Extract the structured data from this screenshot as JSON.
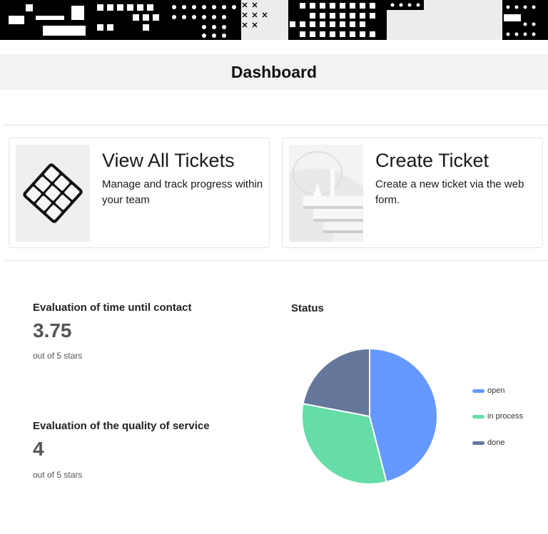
{
  "header": {
    "title": "Dashboard"
  },
  "cards": [
    {
      "title": "View All Tickets",
      "description": "Manage and track progress within your team",
      "icon": "rubiks-cube-image"
    },
    {
      "title": "Create Ticket",
      "description": "Create a new ticket via the web form.",
      "icon": "stairs-image"
    }
  ],
  "ratings": [
    {
      "label": "Evaluation of time until contact",
      "value": "3.75",
      "unit": "out of 5 stars"
    },
    {
      "label": "Evaluation of the quality of service",
      "value": "4",
      "unit": "out of 5 stars"
    }
  ],
  "status_chart": {
    "title": "Status"
  },
  "chart_data": {
    "type": "pie",
    "title": "Status",
    "categories": [
      "open",
      "in process",
      "done"
    ],
    "values": [
      46,
      32,
      22
    ],
    "colors": [
      "#6699ff",
      "#66dca8",
      "#65779a"
    ],
    "legend": "right"
  }
}
